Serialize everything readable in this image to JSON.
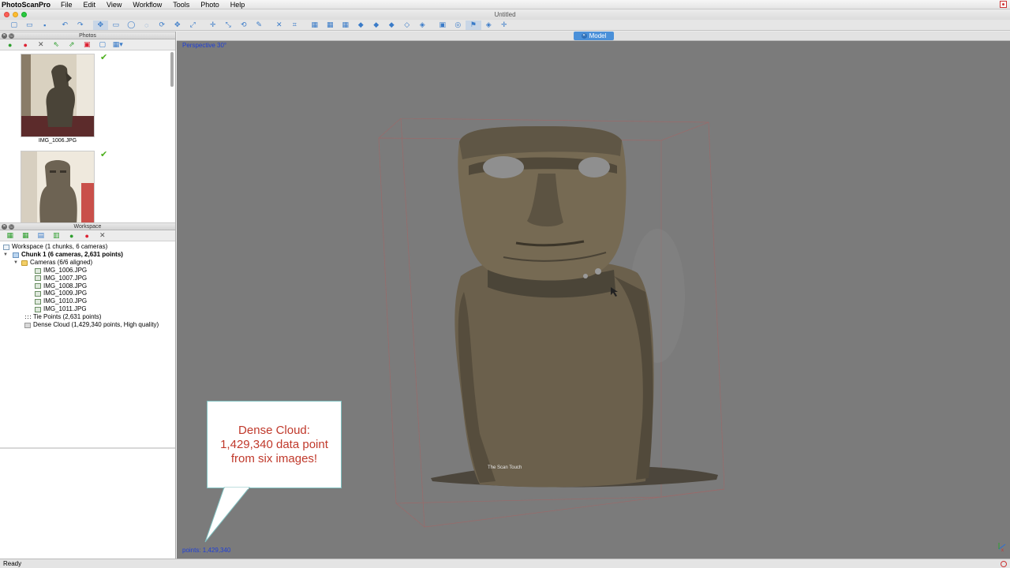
{
  "menubar": {
    "app_name": "PhotoScanPro",
    "menus": [
      "File",
      "Edit",
      "View",
      "Workflow",
      "Tools",
      "Photo",
      "Help"
    ]
  },
  "window": {
    "title": "Untitled"
  },
  "toolbar": {
    "icons": [
      "new-icon",
      "open-icon",
      "save-icon",
      "sep",
      "undo-icon",
      "redo-icon",
      "sep",
      "navigate-icon",
      "rect-select-icon",
      "circle-select-icon",
      "free-select-icon",
      "rotate-object-icon",
      "move-object-icon",
      "scale-object-icon",
      "sep",
      "move-region-icon",
      "resize-region-icon",
      "rotate-region-icon",
      "ruler-icon",
      "sep",
      "delete-icon",
      "crop-icon",
      "sep",
      "show-cameras-icon",
      "show-points-icon",
      "show-dense-icon",
      "show-model-icon",
      "show-shaded-icon",
      "show-solid-icon",
      "show-wireframe-icon",
      "show-textured-icon",
      "sep",
      "screenshot-icon",
      "show-trackball-icon",
      "show-markers-icon",
      "show-region-icon",
      "reset-view-icon"
    ],
    "glyphs": [
      "▢",
      "▭",
      "▪",
      "",
      "↶",
      "↷",
      "",
      "✥",
      "▭",
      "◯",
      "◌",
      "⟳",
      "✥",
      "⤢",
      "",
      "✛",
      "⤡",
      "⟲",
      "✎",
      "",
      "✕",
      "⌗",
      "",
      "▦",
      "▦",
      "▦",
      "◆",
      "◆",
      "◆",
      "◇",
      "◈",
      "",
      "▣",
      "◎",
      "⚑",
      "◈",
      "✛"
    ]
  },
  "photos_panel": {
    "title": "Photos",
    "tools": [
      {
        "name": "enable-icon",
        "glyph": "●",
        "cls": "green"
      },
      {
        "name": "disable-icon",
        "glyph": "●",
        "cls": "red"
      },
      {
        "name": "remove-icon",
        "glyph": "✕",
        "cls": "gray"
      },
      {
        "name": "rotate-left-icon",
        "glyph": "⇖",
        "cls": "green"
      },
      {
        "name": "rotate-right-icon",
        "glyph": "⇗",
        "cls": "green"
      },
      {
        "name": "reset-icon",
        "glyph": "▣",
        "cls": "red"
      },
      {
        "name": "mask-icon",
        "glyph": "▢",
        "cls": "blue"
      },
      {
        "name": "view-mode-icon",
        "glyph": "▦▾",
        "cls": "blue"
      }
    ],
    "photos": [
      {
        "filename": "IMG_1006.JPG",
        "aligned": true
      },
      {
        "filename": "",
        "aligned": true
      }
    ]
  },
  "workspace_panel": {
    "title": "Workspace",
    "tools": [
      {
        "name": "add-chunk-icon",
        "glyph": "▦",
        "cls": "green"
      },
      {
        "name": "add-photos-icon",
        "glyph": "▦",
        "cls": "green"
      },
      {
        "name": "add-folder-icon",
        "glyph": "▤",
        "cls": "blue"
      },
      {
        "name": "merge-icon",
        "glyph": "▥",
        "cls": "green"
      },
      {
        "name": "enable-icon",
        "glyph": "●",
        "cls": "green"
      },
      {
        "name": "disable-icon",
        "glyph": "●",
        "cls": "red"
      },
      {
        "name": "remove-icon",
        "glyph": "✕",
        "cls": "gray"
      }
    ],
    "tree": {
      "workspace": "Workspace (1 chunks, 6 cameras)",
      "chunk": "Chunk 1 (6 cameras, 2,631 points)",
      "cameras_folder": "Cameras (6/6 aligned)",
      "cameras": [
        "IMG_1006.JPG",
        "IMG_1007.JPG",
        "IMG_1008.JPG",
        "IMG_1009.JPG",
        "IMG_1010.JPG",
        "IMG_1011.JPG"
      ],
      "tie_points": "Tie Points (2,631 points)",
      "dense_cloud": "Dense Cloud (1,429,340 points, High quality)"
    }
  },
  "model_view": {
    "tab_label": "Model",
    "projection": "Perspective 30°",
    "points_readout": "points: 1,429,340",
    "overlay_label": "The Scan Touch"
  },
  "callout": {
    "line1": "Dense Cloud:",
    "line2": "1,429,340 data point",
    "line3": "from six images!"
  },
  "status": {
    "text": "Ready"
  },
  "colors": {
    "accent": "#4a90d9",
    "viewport_bg": "#7b7b7b",
    "callout_text": "#c0392b",
    "info_text": "#1f3fd6",
    "aligned_check": "#4caf1c"
  }
}
